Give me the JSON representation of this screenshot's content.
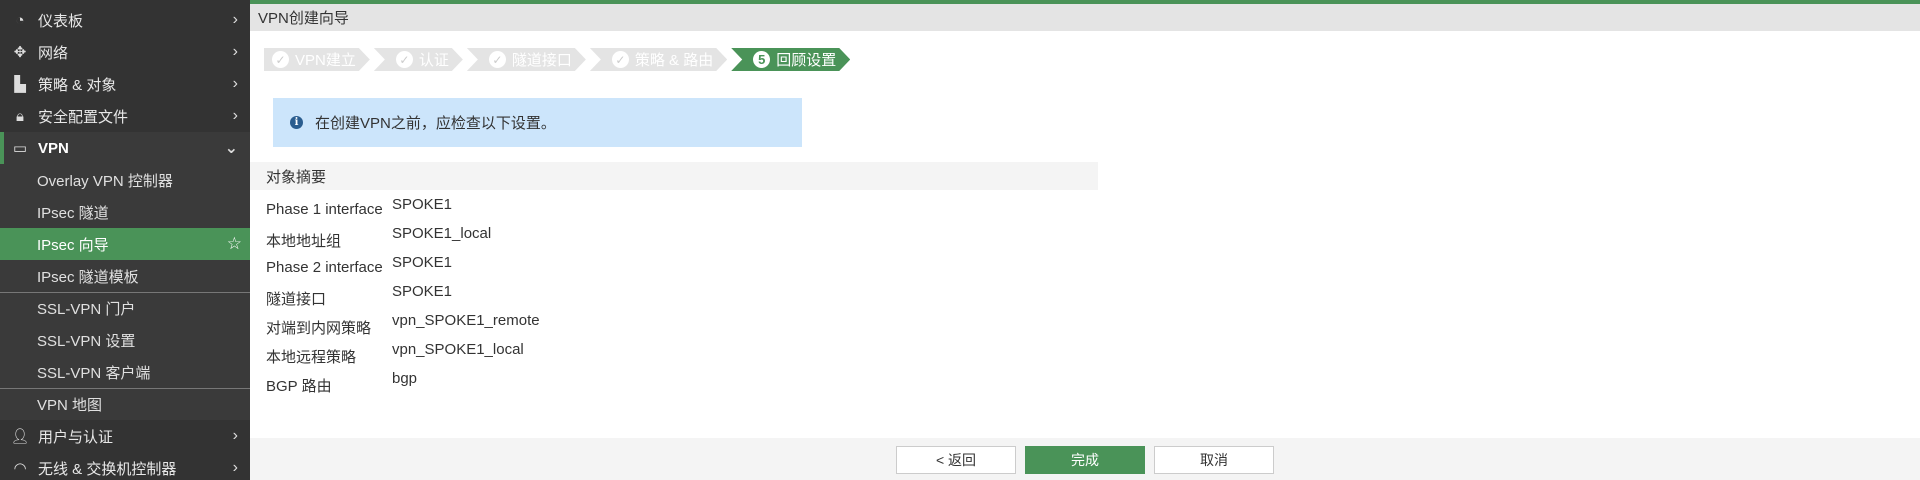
{
  "sidebar": {
    "top_items": [
      {
        "label": "仪表板",
        "icon": "dashboard-icon"
      },
      {
        "label": "网络",
        "icon": "network-move-icon"
      },
      {
        "label": "策略 & 对象",
        "icon": "policy-icon"
      },
      {
        "label": "安全配置文件",
        "icon": "lock-icon"
      }
    ],
    "vpn": {
      "label": "VPN",
      "icon": "laptop-icon"
    },
    "vpn_items": [
      "Overlay VPN 控制器",
      "IPsec 隧道",
      "IPsec 向导",
      "IPsec 隧道模板",
      "SSL-VPN 门户",
      "SSL-VPN 设置",
      "SSL-VPN 客户端",
      "VPN 地图"
    ],
    "bottom_items": [
      {
        "label": "用户与认证",
        "icon": "user-icon"
      },
      {
        "label": "无线 & 交换机控制器",
        "icon": "wifi-icon"
      }
    ]
  },
  "header": {
    "title": "VPN创建向导"
  },
  "steps": [
    {
      "label": "VPN建立",
      "badge": "✓"
    },
    {
      "label": "认证",
      "badge": "✓"
    },
    {
      "label": "隧道接口",
      "badge": "✓"
    },
    {
      "label": "策略 & 路由",
      "badge": "✓"
    },
    {
      "label": "回顾设置",
      "badge": "5"
    }
  ],
  "info": {
    "text": "在创建VPN之前，应检查以下设置。"
  },
  "summary": {
    "title": "对象摘要",
    "rows": [
      {
        "k": "Phase 1 interface",
        "v": "SPOKE1"
      },
      {
        "k": "本地地址组",
        "v": "SPOKE1_local"
      },
      {
        "k": "Phase 2 interface",
        "v": "SPOKE1"
      },
      {
        "k": "隧道接口",
        "v": "SPOKE1"
      },
      {
        "k": "对端到内网策略",
        "v": "vpn_SPOKE1_remote"
      },
      {
        "k": "本地远程策略",
        "v": "vpn_SPOKE1_local"
      },
      {
        "k": "BGP 路由",
        "v": "bgp"
      }
    ]
  },
  "footer": {
    "back": "< 返回",
    "finish": "完成",
    "cancel": "取消"
  },
  "colors": {
    "accent": "#4a9358",
    "sidebar": "#333333",
    "info_bg": "#cce5fb"
  }
}
